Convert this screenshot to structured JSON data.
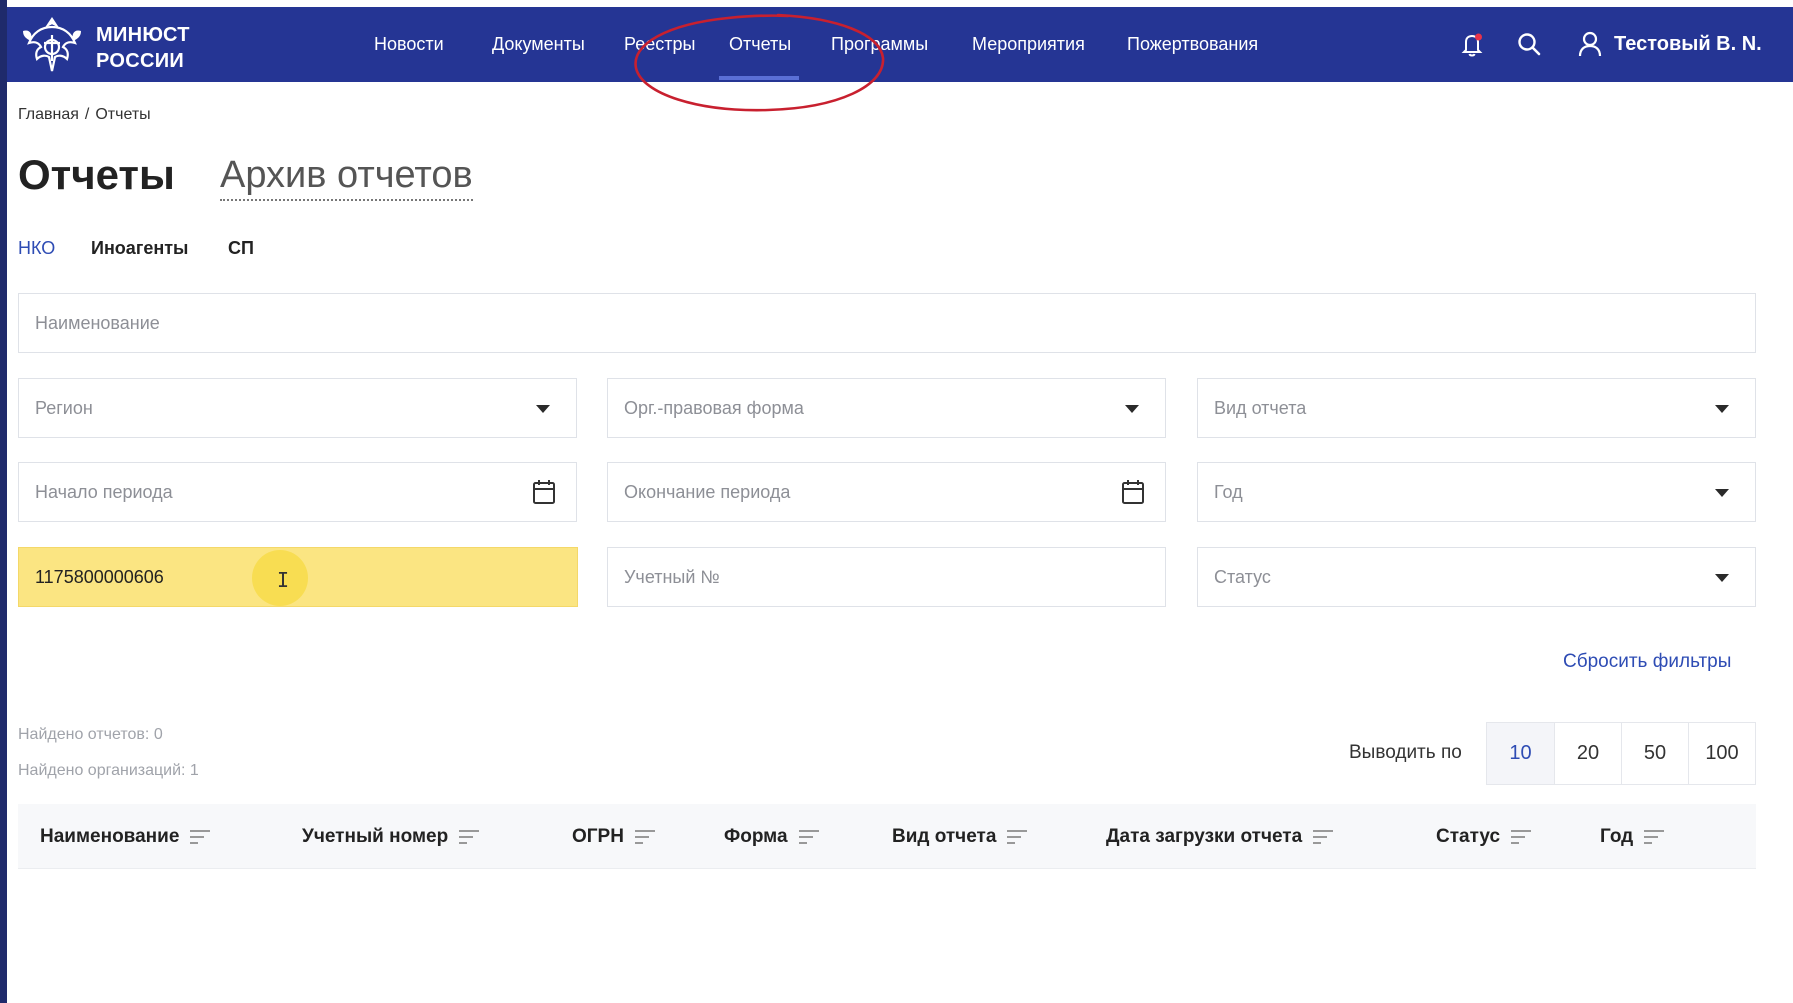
{
  "header": {
    "logo_line1": "МИНЮСТ",
    "logo_line2": "РОССИИ",
    "nav": [
      {
        "label": "Новости"
      },
      {
        "label": "Документы"
      },
      {
        "label": "Реестры"
      },
      {
        "label": "Отчеты",
        "active": true
      },
      {
        "label": "Программы"
      },
      {
        "label": "Мероприятия"
      },
      {
        "label": "Пожертвования"
      }
    ],
    "icons": [
      "bell-icon",
      "search-icon",
      "user-icon"
    ],
    "user_name": "Тестовый В. N.",
    "color": "#253594"
  },
  "breadcrumb": {
    "home": "Главная",
    "separator": "/",
    "current": "Отчеты"
  },
  "page": {
    "title": "Отчеты",
    "archive_link": "Архив отчетов"
  },
  "subtabs": [
    {
      "label": "НКО",
      "active": true
    },
    {
      "label": "Иноагенты"
    },
    {
      "label": "СП"
    }
  ],
  "filters": {
    "name_placeholder": "Наименование",
    "region_placeholder": "Регион",
    "org_form_placeholder": "Орг.-правовая форма",
    "report_type_placeholder": "Вид отчета",
    "period_start_placeholder": "Начало периода",
    "period_end_placeholder": "Окончание периода",
    "year_placeholder": "Год",
    "ogrn_value": "1175800000606",
    "account_no_placeholder": "Учетный №",
    "status_placeholder": "Статус",
    "reset_label": "Сбросить фильтры"
  },
  "results": {
    "reports_found": "Найдено отчетов:  0",
    "orgs_found": "Найдено организаций:  1"
  },
  "pagination": {
    "label": "Выводить по",
    "options": [
      "10",
      "20",
      "50",
      "100"
    ],
    "selected": "10"
  },
  "table": {
    "columns": [
      "Наименование",
      "Учетный номер",
      "ОГРН",
      "Форма",
      "Вид отчета",
      "Дата загрузки отчета",
      "Статус",
      "Год"
    ]
  },
  "colors": {
    "accent": "#2e4cb4",
    "highlight": "#fbe582",
    "annotation": "#c8202f"
  }
}
